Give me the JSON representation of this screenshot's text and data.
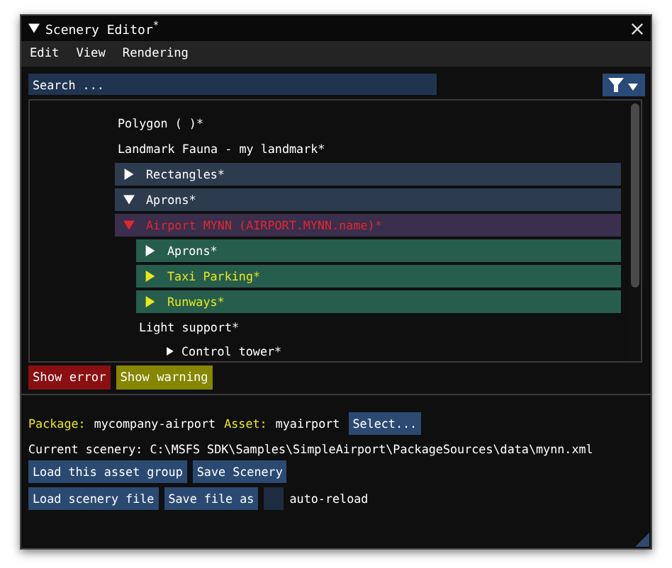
{
  "window": {
    "title": "Scenery Editor",
    "modified_mark": "*"
  },
  "menu": [
    "Edit",
    "View",
    "Rendering"
  ],
  "search": {
    "placeholder": "Search ..."
  },
  "tree": [
    {
      "kind": "text",
      "label": "Polygon  ( )*"
    },
    {
      "kind": "text",
      "label": "Landmark Fauna - my landmark*"
    },
    {
      "kind": "group",
      "label": "Rectangles*",
      "expanded": false,
      "color": "#ffffff"
    },
    {
      "kind": "group",
      "label": "Aprons*",
      "expanded": true,
      "color": "#ffffff"
    },
    {
      "kind": "error_group",
      "label": "Airport MYNN (AIRPORT.MYNN.name)*",
      "expanded": true,
      "color": "#e3262e",
      "children": [
        {
          "kind": "subgroup",
          "label": "Aprons*",
          "expanded": false,
          "color": "#ffffff"
        },
        {
          "kind": "subgroup",
          "label": "Taxi Parking*",
          "expanded": false,
          "color": "#e8e81a"
        },
        {
          "kind": "subgroup",
          "label": "Runways*",
          "expanded": false,
          "color": "#e8e81a"
        },
        {
          "kind": "text",
          "label": "Light support*",
          "children": [
            {
              "kind": "node",
              "label": "Control tower*",
              "expanded": false
            }
          ]
        }
      ]
    }
  ],
  "status_buttons": [
    {
      "kind": "error",
      "label": "Show error"
    },
    {
      "kind": "warning",
      "label": "Show warning"
    }
  ],
  "package": {
    "label": "Package:",
    "value": "mycompany-airport",
    "asset_label": "Asset:",
    "asset_value": "myairport",
    "select_button": "Select..."
  },
  "current_scenery": "Current scenery: C:\\MSFS SDK\\Samples\\SimpleAirport\\PackageSources\\data\\mynn.xml",
  "buttons_row1": [
    "Load this asset group",
    "Save Scenery"
  ],
  "buttons_row2": [
    "Load scenery file",
    "Save file as"
  ],
  "auto_reload": {
    "label": "auto-reload",
    "checked": false
  }
}
